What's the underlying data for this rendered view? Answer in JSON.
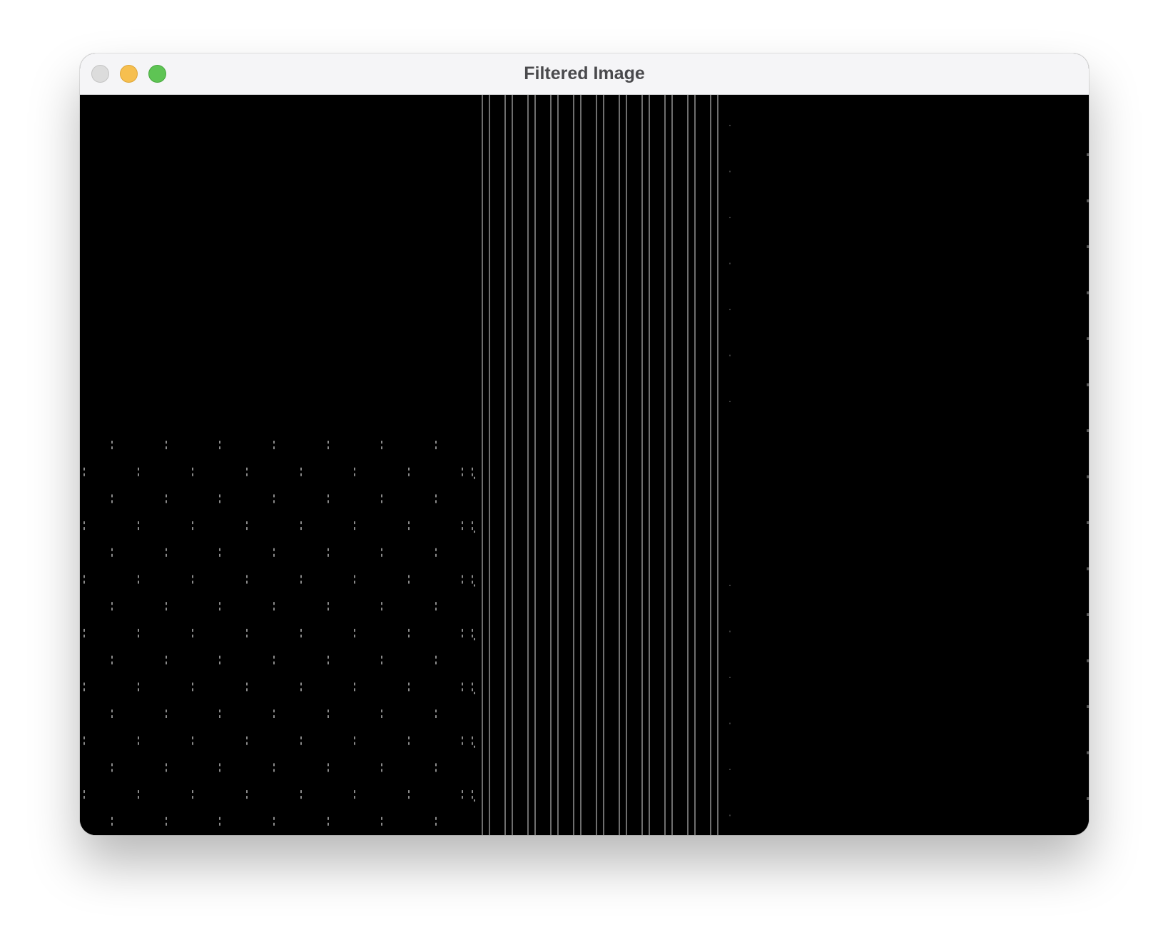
{
  "window": {
    "title": "Filtered Image"
  },
  "titlebar_buttons": [
    {
      "name": "close",
      "color": "#dcdcdc"
    },
    {
      "name": "minimize",
      "color": "#f6bf4f"
    },
    {
      "name": "zoom",
      "color": "#5ec454"
    }
  ],
  "image": {
    "background_color": "#000000",
    "pattern_color": "#8a8a8a",
    "line_color": "#6e6e6e"
  }
}
